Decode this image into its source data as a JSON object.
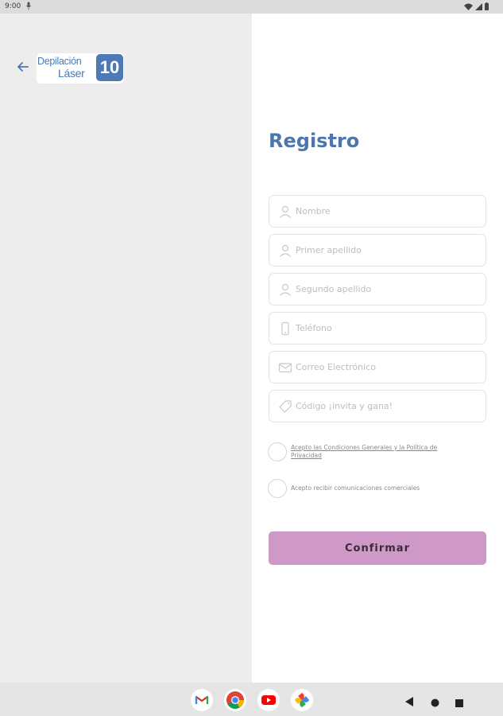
{
  "status_bar": {
    "time": "9:00"
  },
  "header": {
    "logo_line1": "Depilación",
    "logo_line2": "Láser",
    "logo_number": "10"
  },
  "form": {
    "title": "Registro",
    "fields": [
      {
        "placeholder": "Nombre",
        "value": "",
        "icon": "person-icon"
      },
      {
        "placeholder": "Primer apellido",
        "value": "",
        "icon": "person-icon"
      },
      {
        "placeholder": "Segundo apellido",
        "value": "",
        "icon": "person-icon"
      },
      {
        "placeholder": "Teléfono",
        "value": "",
        "icon": "phone-icon"
      },
      {
        "placeholder": "Correo Electrónico",
        "value": "",
        "icon": "mail-icon"
      },
      {
        "placeholder": "Código ¡invita y gana!",
        "value": "",
        "icon": "tag-icon"
      }
    ],
    "terms_label": "Acepto las Condiciones Generales y la Política de Privacidad",
    "marketing_label": "Acepto recibir comunicaciones comerciales",
    "confirm_label": "Confirmar"
  },
  "dock": {
    "apps": [
      "gmail-icon",
      "chrome-icon",
      "youtube-icon",
      "photos-icon"
    ]
  },
  "colors": {
    "accent_blue": "#4d77ac",
    "button_pink": "#cf99c7",
    "left_panel": "#eeeded"
  }
}
